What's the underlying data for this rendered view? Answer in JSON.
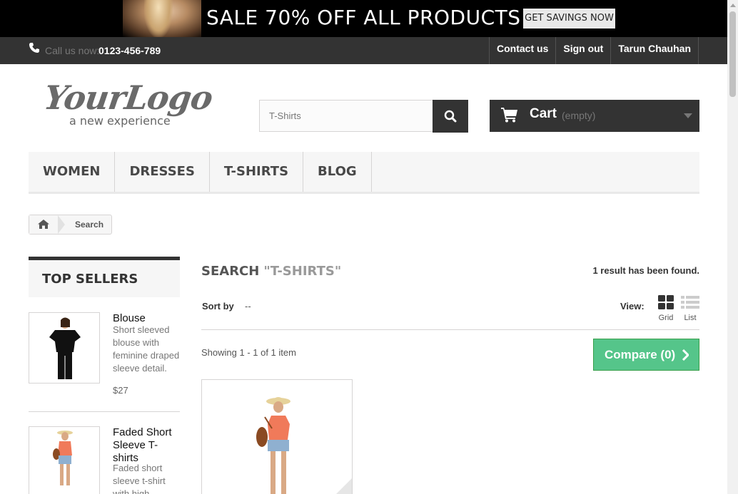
{
  "banner": {
    "headline": "SALE 70% OFF ALL PRODUCTS",
    "cta": "GET SAVINGS NOW"
  },
  "topbar": {
    "call_label": "Call us now:",
    "phone": "0123-456-789",
    "links": [
      "Contact us",
      "Sign out",
      "Tarun Chauhan"
    ]
  },
  "header": {
    "logo_main": "YourLogo",
    "logo_sub": "a new experience",
    "search_value": "T-Shirts",
    "cart_label": "Cart",
    "cart_status": "(empty)"
  },
  "menu": [
    "Women",
    "Dresses",
    "T-shirts",
    "Blog"
  ],
  "breadcrumb": {
    "current": "Search"
  },
  "sidebar": {
    "title": "TOP SELLERS",
    "items": [
      {
        "name": "Blouse",
        "description": "Short sleeved blouse with feminine draped sleeve detail.",
        "price": "$27"
      },
      {
        "name": "Faded Short Sleeve T-shirts",
        "description": "Faded short sleeve t-shirt with high"
      }
    ]
  },
  "content": {
    "heading": "SEARCH",
    "term": "\"T-SHIRTS\"",
    "result_count": "1 result has been found.",
    "sort_label": "Sort by",
    "sort_value": "--",
    "view_label": "View:",
    "view_grid": "Grid",
    "view_list": "List",
    "showing": "Showing 1 - 1 of 1 item",
    "compare": "Compare (0)"
  },
  "colors": {
    "dark": "#333333",
    "compare_green": "#55c58a",
    "menu_bg": "#f6f6f6"
  }
}
